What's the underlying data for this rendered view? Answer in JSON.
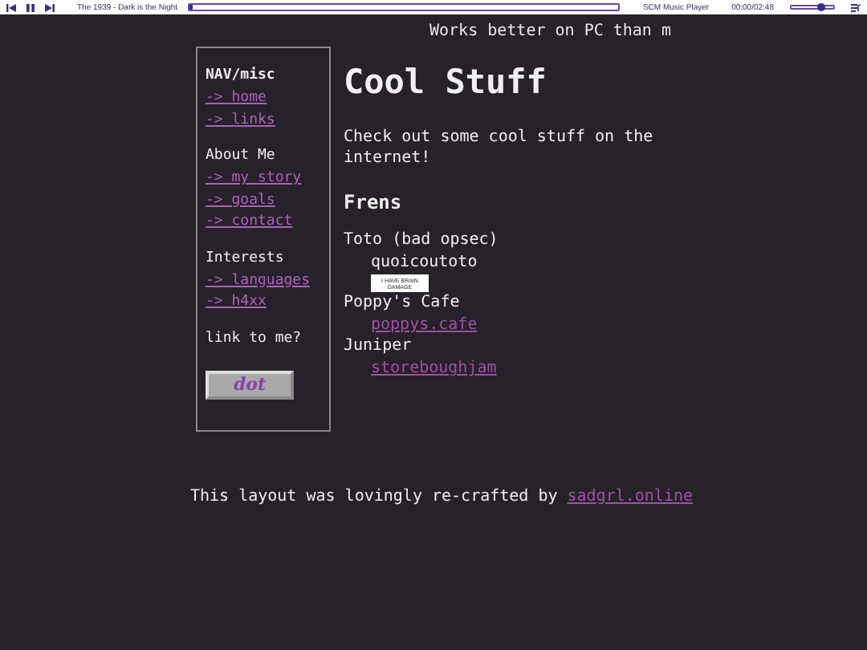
{
  "player": {
    "track": "The 1939 - Dark is the Night",
    "progress": {
      "level": 0.01
    },
    "name": "SCM Music Player",
    "time": "00:00/02:48",
    "volume": {
      "level": 0.7
    }
  },
  "marquee": "Works better on PC than m",
  "sidebar": {
    "sections": [
      {
        "heading": "NAV/misc",
        "bold": true,
        "links": [
          "-> home",
          "-> links"
        ]
      },
      {
        "heading": "About Me",
        "bold": false,
        "links": [
          "-> my story",
          "-> goals",
          "-> contact"
        ]
      },
      {
        "heading": "Interests",
        "bold": false,
        "links": [
          "-> languages",
          "-> h4xx"
        ]
      }
    ],
    "link_prompt": "link to me?",
    "badge": "dot"
  },
  "main": {
    "title": "Cool Stuff",
    "intro": "Check out some cool stuff on the internet!",
    "heading": "Frens",
    "frens": [
      {
        "name": "Toto (bad opsec)",
        "handle": "quoicoutoto",
        "is_link": false,
        "badge": "I HAVE BRAIN DAMAGE"
      },
      {
        "name": "Poppy's Cafe",
        "handle": "poppys.cafe",
        "is_link": true
      },
      {
        "name": "Juniper",
        "handle": "storeboughjam",
        "is_link": true
      }
    ]
  },
  "footer": {
    "text": "This layout was lovingly re-crafted by",
    "link": "sadgrl.online"
  }
}
